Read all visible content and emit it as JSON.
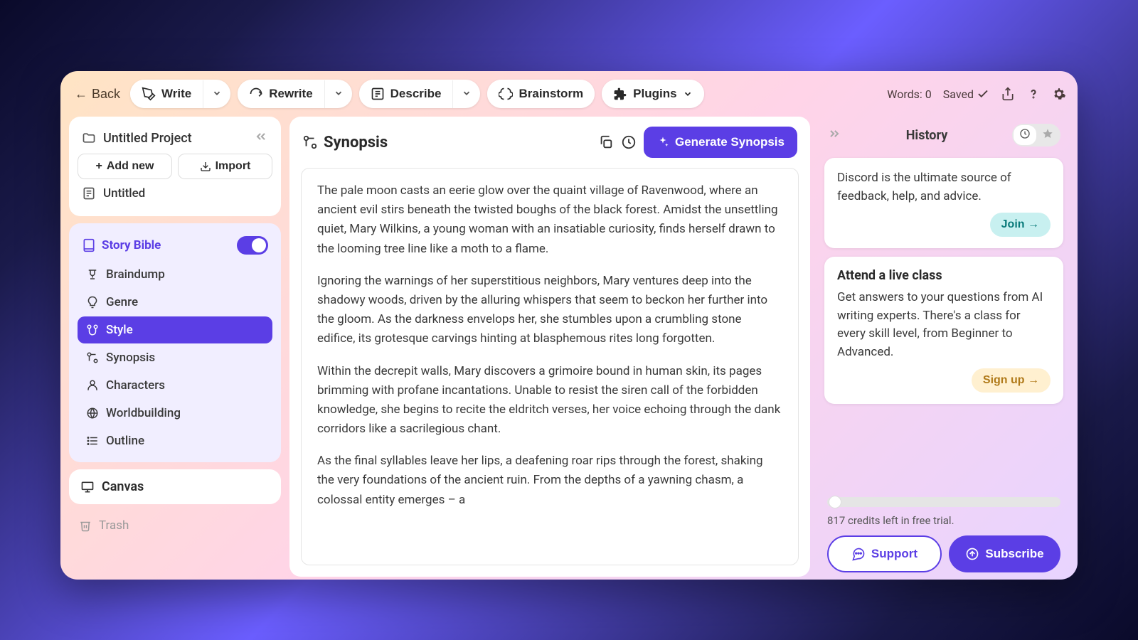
{
  "toolbar": {
    "back": "Back",
    "write": "Write",
    "rewrite": "Rewrite",
    "describe": "Describe",
    "brainstorm": "Brainstorm",
    "plugins": "Plugins",
    "words_label": "Words: 0",
    "saved_label": "Saved"
  },
  "sidebar": {
    "project_title": "Untitled Project",
    "add_new": "Add new",
    "import": "Import",
    "doc_name": "Untitled",
    "bible_title": "Story Bible",
    "items": {
      "braindump": "Braindump",
      "genre": "Genre",
      "style": "Style",
      "synopsis": "Synopsis",
      "characters": "Characters",
      "worldbuilding": "Worldbuilding",
      "outline": "Outline"
    },
    "canvas": "Canvas",
    "trash": "Trash"
  },
  "center": {
    "title": "Synopsis",
    "generate": "Generate Synopsis",
    "p1": "The pale moon casts an eerie glow over the quaint village of Ravenwood, where an ancient evil stirs beneath the twisted boughs of the black forest. Amidst the unsettling quiet, Mary Wilkins, a young woman with an insatiable curiosity, finds herself drawn to the looming tree line like a moth to a flame.",
    "p2": "Ignoring the warnings of her superstitious neighbors, Mary ventures deep into the shadowy woods, driven by the alluring whispers that seem to beckon her further into the gloom. As the darkness envelops her, she stumbles upon a crumbling stone edifice, its grotesque carvings hinting at blasphemous rites long forgotten.",
    "p3": "Within the decrepit walls, Mary discovers a grimoire bound in human skin, its pages brimming with profane incantations. Unable to resist the siren call of the forbidden knowledge, she begins to recite the eldritch verses, her voice echoing through the dank corridors like a sacrilegious chant.",
    "p4": "As the final syllables leave her lips, a deafening roar rips through the forest, shaking the very foundations of the ancient ruin. From the depths of a yawning chasm, a colossal entity emerges – a"
  },
  "right": {
    "history": "History",
    "discord_text": "Discord is the ultimate source of feedback, help, and advice.",
    "join": "Join →",
    "class_title": "Attend a live class",
    "class_text": "Get answers to your questions from AI writing experts. There's a class for every skill level, from Beginner to Advanced.",
    "signup": "Sign up →",
    "credits": "817 credits left in free trial.",
    "support": "Support",
    "subscribe": "Subscribe"
  }
}
